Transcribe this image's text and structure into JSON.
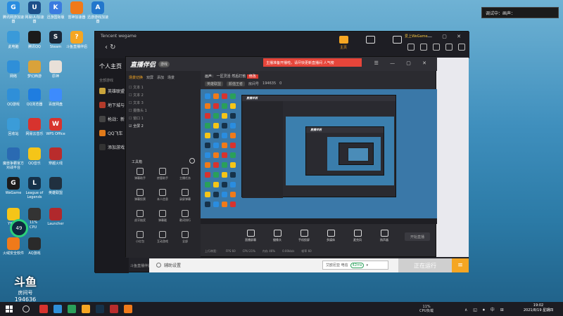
{
  "desktop": {
    "icons": [
      {
        "label": "腾讯网游加速器",
        "glyph": "G",
        "color": "#2a8de0"
      },
      {
        "label": "网易UU加速器",
        "glyph": "U",
        "color": "#1c4f8a"
      },
      {
        "label": "迅游国际版",
        "glyph": "K",
        "color": "#3b7be0"
      },
      {
        "label": "雷神加速器",
        "glyph": "",
        "color": "#f07a1a"
      },
      {
        "label": "迅游游戏加速器",
        "glyph": "A",
        "color": "#2277cc"
      },
      {
        "label": "此电脑",
        "glyph": "",
        "color": "#3a9ad9"
      },
      {
        "label": "腾讯QQ",
        "glyph": "",
        "color": "#1b1b1b"
      },
      {
        "label": "Steam",
        "glyph": "S",
        "color": "#1b2838"
      },
      {
        "label": "斗鱼直播伴侣",
        "glyph": "?",
        "color": "#f5a623"
      },
      {
        "label": "网络",
        "glyph": "",
        "color": "#2f8fd8"
      },
      {
        "label": "梦幻西游",
        "glyph": "",
        "color": "#d9a23a"
      },
      {
        "label": "原神",
        "glyph": "",
        "color": "#e8e0d8"
      },
      {
        "label": "QQ游戏",
        "glyph": "",
        "color": "#2f8fd8"
      },
      {
        "label": "QQ浏览器",
        "glyph": "",
        "color": "#1f7de0"
      },
      {
        "label": "百度网盘",
        "glyph": "",
        "color": "#3d8bfd"
      },
      {
        "label": "回收站",
        "glyph": "",
        "color": "#3b9cd8"
      },
      {
        "label": "网易云音乐",
        "glyph": "",
        "color": "#d7332e"
      },
      {
        "label": "WPS Office",
        "glyph": "W",
        "color": "#d7332e"
      },
      {
        "label": "魔兽争霸官方对战平台",
        "glyph": "",
        "color": "#2a6ab2"
      },
      {
        "label": "QQ音乐",
        "glyph": "",
        "color": "#f5c518"
      },
      {
        "label": "穿越火线",
        "glyph": "",
        "color": "#b92c2c"
      },
      {
        "label": "WeGame",
        "glyph": "G",
        "color": "#1b1b1b"
      },
      {
        "label": "League of Legends",
        "glyph": "L",
        "color": "#16324a"
      },
      {
        "label": "英雄联盟",
        "glyph": "",
        "color": "#20303f"
      },
      {
        "label": "YY语音",
        "glyph": "",
        "color": "#f5c518"
      },
      {
        "label": "",
        "glyph": "",
        "color": "#333"
      },
      {
        "label": "Launcher",
        "glyph": "",
        "color": "#b0282c"
      },
      {
        "label": "火绒安全软件",
        "glyph": "",
        "color": "#f07a1a"
      },
      {
        "label": "AQ游戏",
        "glyph": "",
        "color": "#2a2a2a"
      }
    ],
    "gauge": {
      "value": "49",
      "side_top": "11%",
      "side_bottom": "CPU"
    },
    "watermark": {
      "logo": "斗鱼",
      "label": "房间号",
      "room_id": "194636"
    }
  },
  "notification": {
    "text": "调试中：画声："
  },
  "wegame": {
    "brand": "Tencent wegame",
    "nav": "‹   ↻",
    "tabs": [
      {
        "label": "主页",
        "active": true
      },
      {
        "label": "",
        "active": false
      },
      {
        "label": "",
        "active": false
      }
    ],
    "user": "爱上WeGame",
    "window_controls": "— ▢ ✕",
    "sidebar": {
      "title": "个人主页",
      "subtitle": "全部游戏",
      "items": [
        {
          "label": "英雄联盟",
          "color": "#c9a43b"
        },
        {
          "label": "地下城与",
          "color": "#b23a2a"
        },
        {
          "label": "枪战：新",
          "color": "#444"
        },
        {
          "label": "QQ飞车",
          "color": "#e07a1a"
        },
        {
          "label": "添加游戏",
          "color": "#333"
        }
      ]
    },
    "bottom": {
      "assist": "辅助设置",
      "game_select": "艾欧尼亚 电信",
      "ping": "42ms",
      "running_label": "正在运行",
      "menu_icon": "≡"
    }
  },
  "streamer_app": {
    "logo": "直播伴侣",
    "badge": "游戏",
    "alert": "主播准备开播啦，请尽快更新直播间 人气榜",
    "head_controls": "☰ — ▢ ✕",
    "scene_tabs": [
      {
        "label": "场景切换",
        "active": true
      },
      {
        "label": "双屏",
        "active": false
      },
      {
        "label": "添加",
        "active": false
      },
      {
        "label": "场景",
        "active": false
      }
    ],
    "scenes": [
      {
        "label": "☐  文本 1",
        "active": false
      },
      {
        "label": "☐  文本 2",
        "active": false
      },
      {
        "label": "☐  文本 3",
        "active": false
      },
      {
        "label": "☐  摄像头 1",
        "active": false
      },
      {
        "label": "☐  窗口 1",
        "active": false
      },
      {
        "label": "☑  全屏 2",
        "active": true
      }
    ],
    "tools_title": "工具箱",
    "tools": [
      {
        "label": "弹幕助手"
      },
      {
        "label": "房管助手"
      },
      {
        "label": "主播任务"
      },
      {
        "label": "弹幕投票"
      },
      {
        "label": "本人信息"
      },
      {
        "label": "录屏弹幕"
      },
      {
        "label": "虎牙抽奖"
      },
      {
        "label": "弹幕截"
      },
      {
        "label": "歌词排行"
      },
      {
        "label": "小红包"
      },
      {
        "label": "互动游戏"
      },
      {
        "label": "全部"
      }
    ],
    "footer": "斗鱼直播伴侣使用教程",
    "room": {
      "title_prefix": "画声：",
      "title": "一区灵活 然后打勃",
      "tag": "修改",
      "meta_category": "英雄联盟",
      "meta_sub": "颜值王者",
      "meta_id_label": "房间号",
      "meta_id": "194635",
      "meta_count": "0"
    },
    "controls": [
      {
        "label": "直播屏幕"
      },
      {
        "label": "摄像头"
      },
      {
        "label": "手机投屏"
      },
      {
        "label": "多媒体"
      },
      {
        "label": "麦克风"
      },
      {
        "label": "扬声器"
      }
    ],
    "start_live": "开始直播",
    "status_items": [
      "上行带宽：",
      "FPS 60",
      "CPU 21%",
      "内存 46%",
      "0.00kb/s",
      "帧率 60"
    ]
  },
  "nested": {
    "head1": "直播伴侣",
    "head2": "直播伴侣"
  },
  "taskbar": {
    "cpu_top": "11%",
    "cpu_bottom": "CPU负载",
    "tray": "∧ ◱ ⏺ 中 ⊞",
    "time": "19:02",
    "date": "2021/8/19 星期四",
    "apps": [
      {
        "color": "#d7332e"
      },
      {
        "color": "#2f8fd8"
      },
      {
        "color": "#2aa05a"
      },
      {
        "color": "#f5a623"
      },
      {
        "color": "#16324a"
      },
      {
        "color": "#b92c2c"
      },
      {
        "color": "#f07a1a"
      }
    ]
  }
}
